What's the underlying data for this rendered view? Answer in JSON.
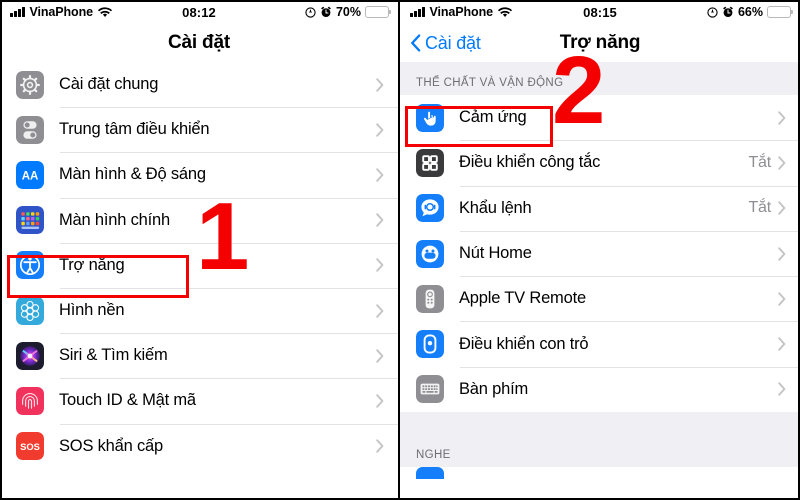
{
  "left_phone": {
    "status_bar": {
      "carrier": "VinaPhone",
      "time": "08:12",
      "battery_percent": "70%",
      "battery_level": 70,
      "signal_icon": "signal-bars-icon",
      "wifi_icon": "wifi-icon",
      "location_icon": "location-services-icon",
      "alarm_icon": "alarm-clock-icon",
      "battery_icon": "battery-icon",
      "battery_color": "#ffcc00"
    },
    "nav": {
      "title": "Cài đặt"
    },
    "rows": [
      {
        "label": "Cài đặt chung",
        "icon": "gear-icon",
        "icon_bg": "#8e8e93",
        "value": ""
      },
      {
        "label": "Trung tâm điều khiển",
        "icon": "control-center-icon",
        "icon_bg": "#8e8e93",
        "value": ""
      },
      {
        "label": "Màn hình & Độ sáng",
        "icon": "display-brightness-icon",
        "icon_bg": "#007aff",
        "value": ""
      },
      {
        "label": "Màn hình chính",
        "icon": "home-screen-icon",
        "icon_bg": "#2f54c8",
        "value": ""
      },
      {
        "label": "Trợ năng",
        "icon": "accessibility-icon",
        "icon_bg": "#147efb",
        "value": ""
      },
      {
        "label": "Hình nền",
        "icon": "wallpaper-icon",
        "icon_bg": "#34aadc",
        "value": ""
      },
      {
        "label": "Siri & Tìm kiếm",
        "icon": "siri-icon",
        "icon_bg": "#1c1c2e",
        "value": ""
      },
      {
        "label": "Touch ID & Mật mã",
        "icon": "touch-id-icon",
        "icon_bg": "#f0325c",
        "value": ""
      },
      {
        "label": "SOS khẩn cấp",
        "icon": "sos-icon",
        "icon_bg": "#f23b2f",
        "value": ""
      }
    ],
    "annotation": {
      "number": "1"
    }
  },
  "right_phone": {
    "status_bar": {
      "carrier": "VinaPhone",
      "time": "08:15",
      "battery_percent": "66%",
      "battery_level": 66,
      "signal_icon": "signal-bars-icon",
      "wifi_icon": "wifi-icon",
      "location_icon": "location-services-icon",
      "alarm_icon": "alarm-clock-icon",
      "battery_icon": "battery-icon",
      "battery_color": "#ffcc00"
    },
    "nav": {
      "back_label": "Cài đặt",
      "back_icon": "chevron-left-icon",
      "title": "Trợ năng"
    },
    "section_header_1": "THỂ CHẤT VÀ VẬN ĐỘNG",
    "rows": [
      {
        "label": "Cảm ứng",
        "icon": "touch-hand-icon",
        "icon_bg": "#147efb",
        "value": ""
      },
      {
        "label": "Điều khiển công tắc",
        "icon": "switch-control-icon",
        "icon_bg": "#3a3a3c",
        "value": "Tắt"
      },
      {
        "label": "Khẩu lệnh",
        "icon": "voice-control-icon",
        "icon_bg": "#147efb",
        "value": "Tắt"
      },
      {
        "label": "Nút Home",
        "icon": "home-button-icon",
        "icon_bg": "#147efb",
        "value": ""
      },
      {
        "label": "Apple TV Remote",
        "icon": "apple-tv-remote-icon",
        "icon_bg": "#8e8e93",
        "value": ""
      },
      {
        "label": "Điều khiển con trỏ",
        "icon": "pointer-control-icon",
        "icon_bg": "#147efb",
        "value": ""
      },
      {
        "label": "Bàn phím",
        "icon": "keyboard-icon",
        "icon_bg": "#8e8e93",
        "value": ""
      }
    ],
    "section_header_2": "NGHE",
    "annotation": {
      "number": "2"
    }
  },
  "theme": {
    "highlight_color": "#f40000",
    "accent_blue": "#007aff",
    "group_bg": "#efeff4",
    "separator": "#e3e3e6",
    "value_text": "#8e8e93"
  }
}
